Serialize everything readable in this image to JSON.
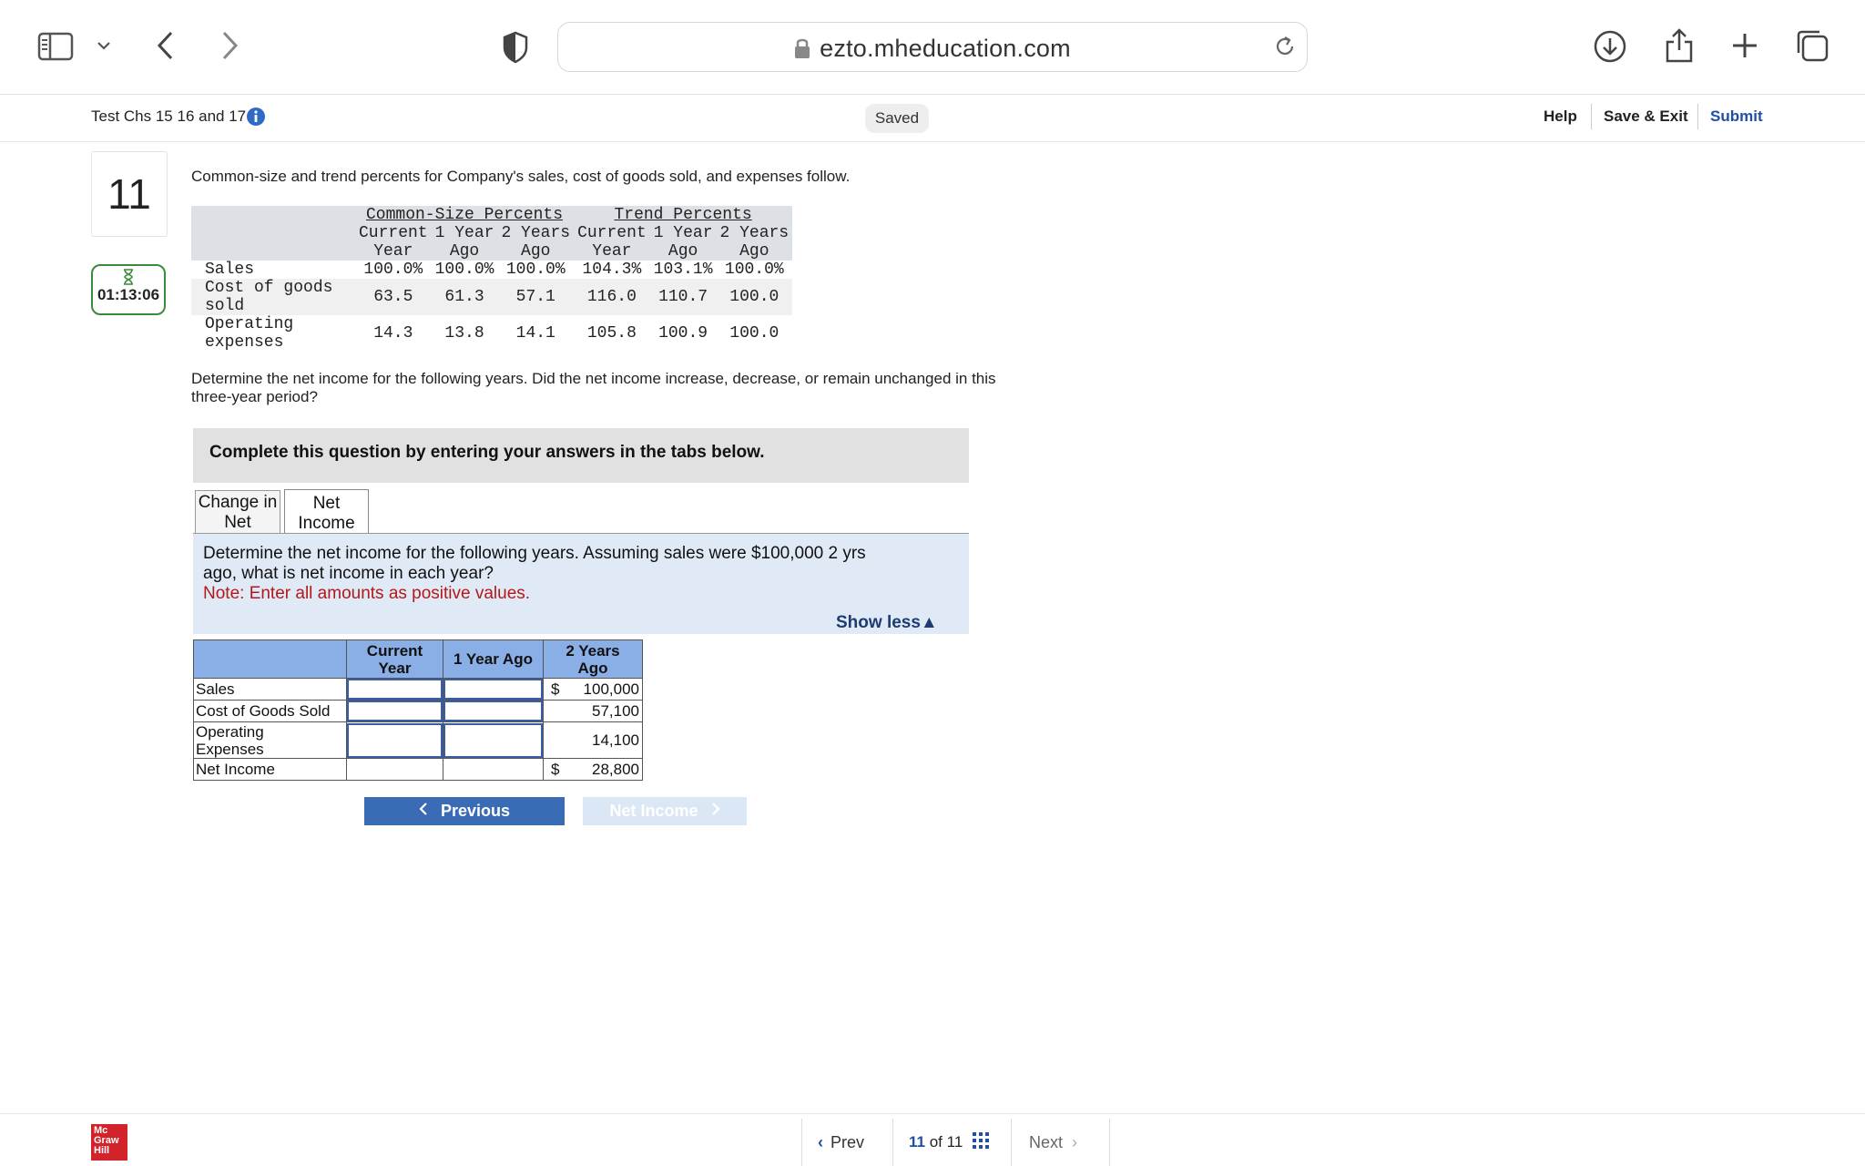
{
  "browser": {
    "url": "ezto.mheducation.com"
  },
  "header": {
    "test_title": "Test Chs 15 16 and 17",
    "saved_label": "Saved",
    "help_label": "Help",
    "save_exit_label": "Save & Exit",
    "submit_label": "Submit"
  },
  "question": {
    "number": "11",
    "timer": "01:13:06",
    "intro": "Common-size and trend percents for Company's sales, cost of goods sold, and expenses follow.",
    "table": {
      "group_common": "Common-Size Percents",
      "group_trend": "Trend Percents",
      "col_top": [
        "Current",
        "1 Year",
        "2 Years",
        "Current",
        "1 Year",
        "2 Years"
      ],
      "col_bottom": [
        "Year",
        "Ago",
        "Ago",
        "Year",
        "Ago",
        "Ago"
      ],
      "rows": [
        {
          "label1": "Sales",
          "label2": "",
          "values": [
            "100.0%",
            "100.0%",
            "100.0%",
            "104.3%",
            "103.1%",
            "100.0%"
          ]
        },
        {
          "label1": "Cost of goods",
          "label2": "sold",
          "values": [
            "63.5",
            "61.3",
            "57.1",
            "116.0",
            "110.7",
            "100.0"
          ]
        },
        {
          "label1": "Operating",
          "label2": "expenses",
          "values": [
            "14.3",
            "13.8",
            "14.1",
            "105.8",
            "100.9",
            "100.0"
          ]
        }
      ]
    },
    "prompt_line1": "Determine the net income for the following years. Did the net income increase, decrease, or remain unchanged in this",
    "prompt_line2": "three-year period?",
    "instruction": "Complete this question by entering your answers in the tabs below.",
    "tabs": [
      {
        "line1": "Change in",
        "line2": "Net"
      },
      {
        "line1": "Net",
        "line2": "Income"
      }
    ],
    "subprompt_line1": "Determine the net income for the following years. Assuming sales were $100,000 2 yrs",
    "subprompt_line2": "ago, what is net income in each year?",
    "note": "Note: Enter all amounts as positive values.",
    "show_less": "Show less",
    "answer_table": {
      "headers": [
        {
          "l1": "Current",
          "l2": "Year"
        },
        {
          "l1": "1 Year Ago",
          "l2": ""
        },
        {
          "l1": "2 Years",
          "l2": "Ago"
        }
      ],
      "rows": [
        {
          "label1": "Sales",
          "label2": "",
          "dollar": "$",
          "value": "100,000"
        },
        {
          "label1": "Cost of Goods Sold",
          "label2": "",
          "dollar": "",
          "value": "57,100"
        },
        {
          "label1": "Operating",
          "label2": "Expenses",
          "dollar": "",
          "value": "14,100"
        },
        {
          "label1": "Net Income",
          "label2": "",
          "dollar": "$",
          "value": "28,800"
        }
      ]
    },
    "prev_label": "Previous",
    "next_label": "Net Income"
  },
  "footer": {
    "logo_l1": "Mc",
    "logo_l2": "Graw",
    "logo_l3": "Hill",
    "prev_label": "Prev",
    "page_current": "11",
    "page_of": "of 11",
    "next_label": "Next"
  }
}
